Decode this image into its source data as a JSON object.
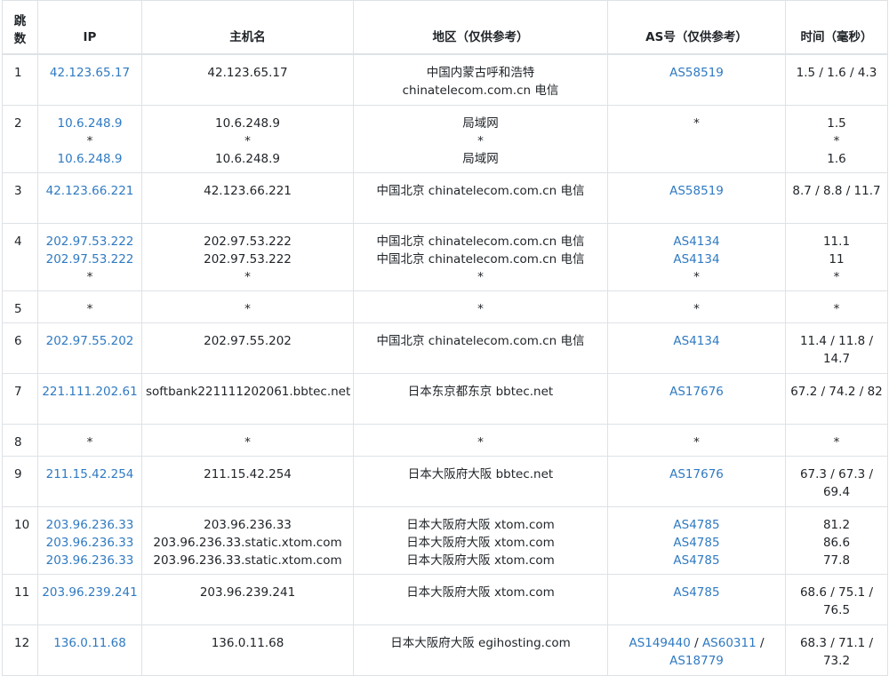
{
  "colors": {
    "link": "#2f7ac2",
    "text": "#212529",
    "border": "#dee2e6"
  },
  "headers": {
    "hop_line1": "跳",
    "hop_line2": "数",
    "ip": "IP",
    "hostname": "主机名",
    "region": "地区（仅供参考）",
    "as": "AS号（仅供参考）",
    "time": "时间（毫秒）"
  },
  "rows": [
    {
      "hop": "1",
      "ips": [
        "42.123.65.17"
      ],
      "hosts": [
        "42.123.65.17"
      ],
      "regions": [
        "中国内蒙古呼和浩特",
        "chinatelecom.com.cn 电信"
      ],
      "as": [
        [
          "AS58519"
        ]
      ],
      "time": [
        "1.5 / 1.6 / 4.3"
      ]
    },
    {
      "hop": "2",
      "ips": [
        "10.6.248.9",
        "*",
        "10.6.248.9"
      ],
      "hosts": [
        "10.6.248.9",
        "*",
        "10.6.248.9"
      ],
      "regions": [
        "局域网",
        "*",
        "局域网"
      ],
      "as": [
        [
          "*"
        ]
      ],
      "time": [
        "1.5",
        "*",
        "1.6"
      ]
    },
    {
      "hop": "3",
      "ips": [
        "42.123.66.221"
      ],
      "hosts": [
        "42.123.66.221"
      ],
      "regions": [
        "中国北京 chinatelecom.com.cn 电信"
      ],
      "as": [
        [
          "AS58519"
        ]
      ],
      "time": [
        "8.7 / 8.8 / 11.7"
      ]
    },
    {
      "hop": "4",
      "ips": [
        "202.97.53.222",
        "202.97.53.222",
        "*"
      ],
      "hosts": [
        "202.97.53.222",
        "202.97.53.222",
        "*"
      ],
      "regions": [
        "中国北京 chinatelecom.com.cn 电信",
        "中国北京 chinatelecom.com.cn 电信",
        "*"
      ],
      "as": [
        [
          "AS4134"
        ],
        [
          "AS4134"
        ],
        [
          "*"
        ]
      ],
      "time": [
        "11.1",
        "11",
        "*"
      ]
    },
    {
      "hop": "5",
      "ips": [
        "*"
      ],
      "hosts": [
        "*"
      ],
      "regions": [
        "*"
      ],
      "as": [
        [
          "*"
        ]
      ],
      "time": [
        "*"
      ]
    },
    {
      "hop": "6",
      "ips": [
        "202.97.55.202"
      ],
      "hosts": [
        "202.97.55.202"
      ],
      "regions": [
        "中国北京 chinatelecom.com.cn 电信"
      ],
      "as": [
        [
          "AS4134"
        ]
      ],
      "time": [
        "11.4 / 11.8 / 14.7"
      ]
    },
    {
      "hop": "7",
      "ips": [
        "221.111.202.61"
      ],
      "hosts": [
        "softbank221111202061.bbtec.net"
      ],
      "regions": [
        "日本东京都东京 bbtec.net"
      ],
      "as": [
        [
          "AS17676"
        ]
      ],
      "time": [
        "67.2 / 74.2 / 82"
      ]
    },
    {
      "hop": "8",
      "ips": [
        "*"
      ],
      "hosts": [
        "*"
      ],
      "regions": [
        "*"
      ],
      "as": [
        [
          "*"
        ]
      ],
      "time": [
        "*"
      ]
    },
    {
      "hop": "9",
      "ips": [
        "211.15.42.254"
      ],
      "hosts": [
        "211.15.42.254"
      ],
      "regions": [
        "日本大阪府大阪 bbtec.net"
      ],
      "as": [
        [
          "AS17676"
        ]
      ],
      "time": [
        "67.3 / 67.3 / 69.4"
      ]
    },
    {
      "hop": "10",
      "ips": [
        "203.96.236.33",
        "203.96.236.33",
        "203.96.236.33"
      ],
      "hosts": [
        "203.96.236.33",
        "203.96.236.33.static.xtom.com",
        "203.96.236.33.static.xtom.com"
      ],
      "regions": [
        "日本大阪府大阪 xtom.com",
        "日本大阪府大阪 xtom.com",
        "日本大阪府大阪 xtom.com"
      ],
      "as": [
        [
          "AS4785"
        ],
        [
          "AS4785"
        ],
        [
          "AS4785"
        ]
      ],
      "time": [
        "81.2",
        "86.6",
        "77.8"
      ]
    },
    {
      "hop": "11",
      "ips": [
        "203.96.239.241"
      ],
      "hosts": [
        "203.96.239.241"
      ],
      "regions": [
        "日本大阪府大阪 xtom.com"
      ],
      "as": [
        [
          "AS4785"
        ]
      ],
      "time": [
        "68.6 / 75.1 / 76.5"
      ]
    },
    {
      "hop": "12",
      "ips": [
        "136.0.11.68"
      ],
      "hosts": [
        "136.0.11.68"
      ],
      "regions": [
        "日本大阪府大阪 egihosting.com"
      ],
      "as": [
        [
          "AS149440",
          "AS60311",
          "AS18779"
        ]
      ],
      "time": [
        "68.3 / 71.1 / 73.2"
      ]
    }
  ]
}
